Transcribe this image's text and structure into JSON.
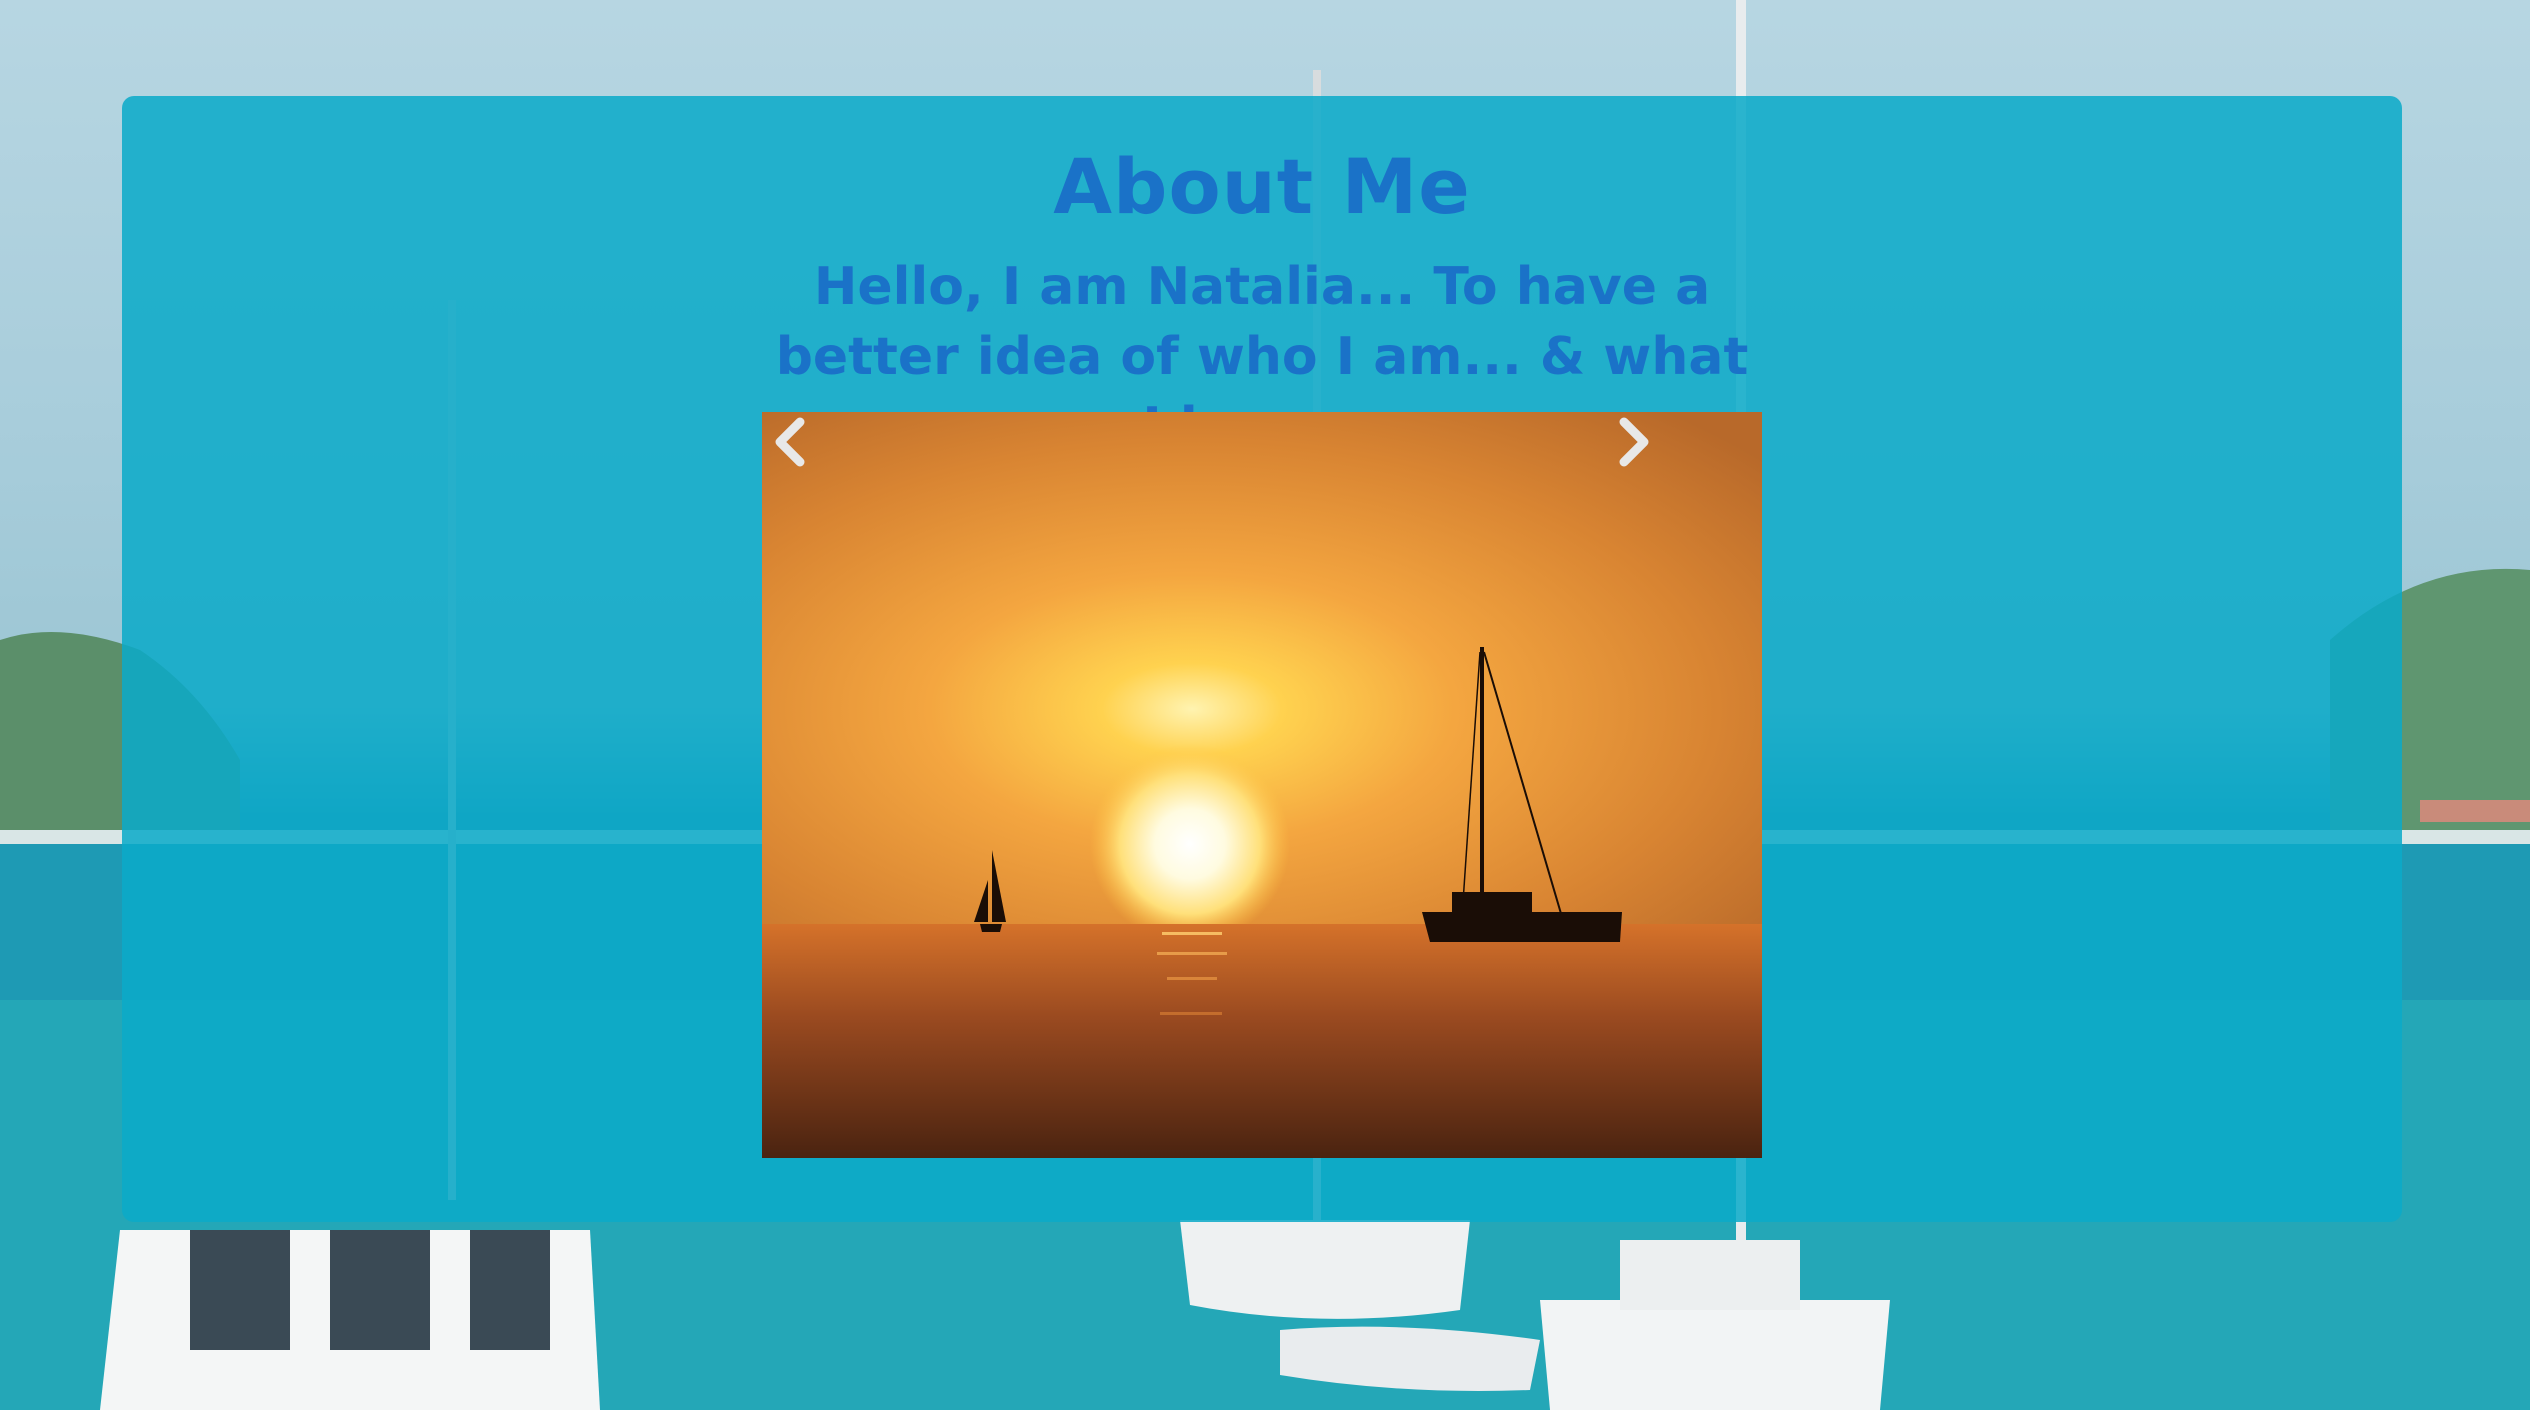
{
  "page": {
    "title": "About Me",
    "intro": "Hello, I am Natalia... To have a better idea of who I am... & what I love...."
  },
  "carousel": {
    "prev_icon": "chevron-left-icon",
    "next_icon": "chevron-right-icon"
  },
  "colors": {
    "panel": "#0aaac8",
    "heading": "#1a72c8"
  }
}
